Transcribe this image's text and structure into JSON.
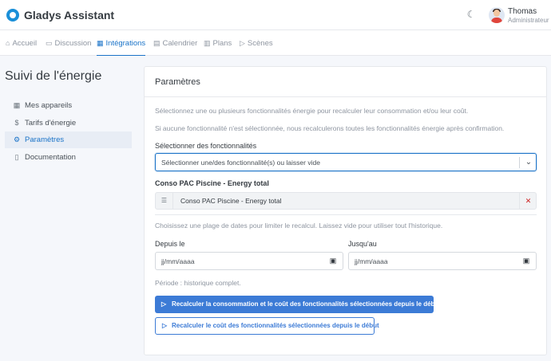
{
  "app": {
    "title": "Gladys Assistant"
  },
  "user": {
    "name": "Thomas",
    "role": "Administrateur"
  },
  "nav": {
    "items": [
      {
        "label": "Accueil",
        "icon": "home-icon"
      },
      {
        "label": "Discussion",
        "icon": "message-square-icon"
      },
      {
        "label": "Intégrations",
        "icon": "grid-icon",
        "active": true
      },
      {
        "label": "Calendrier",
        "icon": "calendar-icon"
      },
      {
        "label": "Plans",
        "icon": "map-icon"
      },
      {
        "label": "Scènes",
        "icon": "play-icon"
      }
    ]
  },
  "sidebar": {
    "title": "Suivi de l'énergie",
    "items": [
      {
        "label": "Mes appareils",
        "icon": "grid-icon"
      },
      {
        "label": "Tarifs d'énergie",
        "icon": "dollar-icon"
      },
      {
        "label": "Paramètres",
        "icon": "gear-icon",
        "active": true
      },
      {
        "label": "Documentation",
        "icon": "book-icon"
      }
    ]
  },
  "card": {
    "title": "Paramètres",
    "intro1": "Sélectionnez une ou plusieurs fonctionnalités énergie pour recalculer leur consommation et/ou leur coût.",
    "intro2": "Si aucune fonctionnalité n'est sélectionnée, nous recalculerons toutes les fonctionnalités énergie après confirmation.",
    "select_label": "Sélectionner des fonctionnalités",
    "select_placeholder": "Sélectionner une/des fonctionnalité(s) ou laisser vide",
    "feature_group_label": "Conso PAC Piscine - Energy total",
    "selected_feature": "Conso PAC Piscine - Energy total",
    "date_hint": "Choisissez une plage de dates pour limiter le recalcul. Laissez vide pour utiliser tout l'historique.",
    "from_label": "Depuis le",
    "to_label": "Jusqu'au",
    "date_placeholder": "jj/mm/aaaa",
    "period_text": "Période : historique complet.",
    "btn_primary": "Recalculer la consommation et le coût des fonctionnalités sélectionnées depuis le début",
    "btn_secondary": "Recalculer le coût des fonctionnalités sélectionnées depuis le début"
  },
  "colors": {
    "accent": "#1a73c8",
    "primary_button": "#3c7bd6",
    "danger": "#cd201f"
  }
}
